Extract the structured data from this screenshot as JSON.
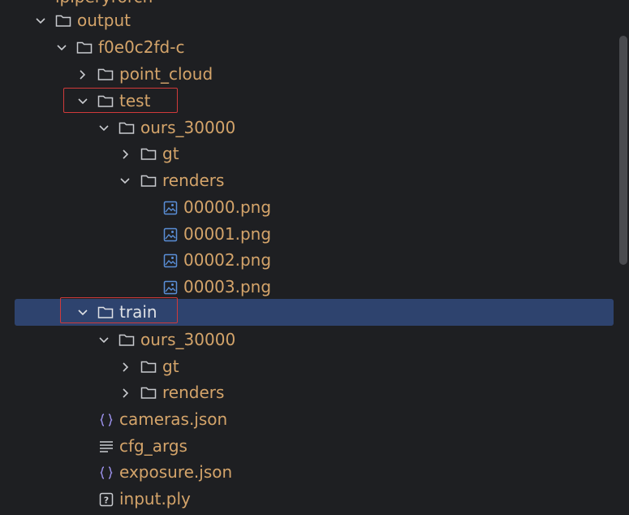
{
  "tree": {
    "partial_top": {
      "label": "ipiperyrorch"
    },
    "rows": [
      {
        "label": "output",
        "kind": "folder",
        "expanded": true
      },
      {
        "label": "f0e0c2fd-c",
        "kind": "folder",
        "expanded": true
      },
      {
        "label": "point_cloud",
        "kind": "folder",
        "expanded": false
      },
      {
        "label": "test",
        "kind": "folder",
        "expanded": true,
        "highlighted": true
      },
      {
        "label": "ours_30000",
        "kind": "folder",
        "expanded": true
      },
      {
        "label": "gt",
        "kind": "folder",
        "expanded": false
      },
      {
        "label": "renders",
        "kind": "folder",
        "expanded": true
      },
      {
        "label": "00000.png",
        "kind": "image"
      },
      {
        "label": "00001.png",
        "kind": "image"
      },
      {
        "label": "00002.png",
        "kind": "image"
      },
      {
        "label": "00003.png",
        "kind": "image"
      },
      {
        "label": "train",
        "kind": "folder",
        "expanded": true,
        "selected": true,
        "highlighted": true
      },
      {
        "label": "ours_30000",
        "kind": "folder",
        "expanded": true
      },
      {
        "label": "gt",
        "kind": "folder",
        "expanded": false
      },
      {
        "label": "renders",
        "kind": "folder",
        "expanded": false
      },
      {
        "label": "cameras.json",
        "kind": "json"
      },
      {
        "label": "cfg_args",
        "kind": "text"
      },
      {
        "label": "exposure.json",
        "kind": "json"
      },
      {
        "label": "input.ply",
        "kind": "unknown"
      }
    ]
  },
  "colors": {
    "background": "#1e1f22",
    "label": "#d4a46a",
    "selected_row": "#2e436e",
    "highlight_box": "#d03a3a",
    "icon": "#c9cbcf",
    "image_icon": "#5a8fd8",
    "json_icon": "#9a8fe8"
  }
}
